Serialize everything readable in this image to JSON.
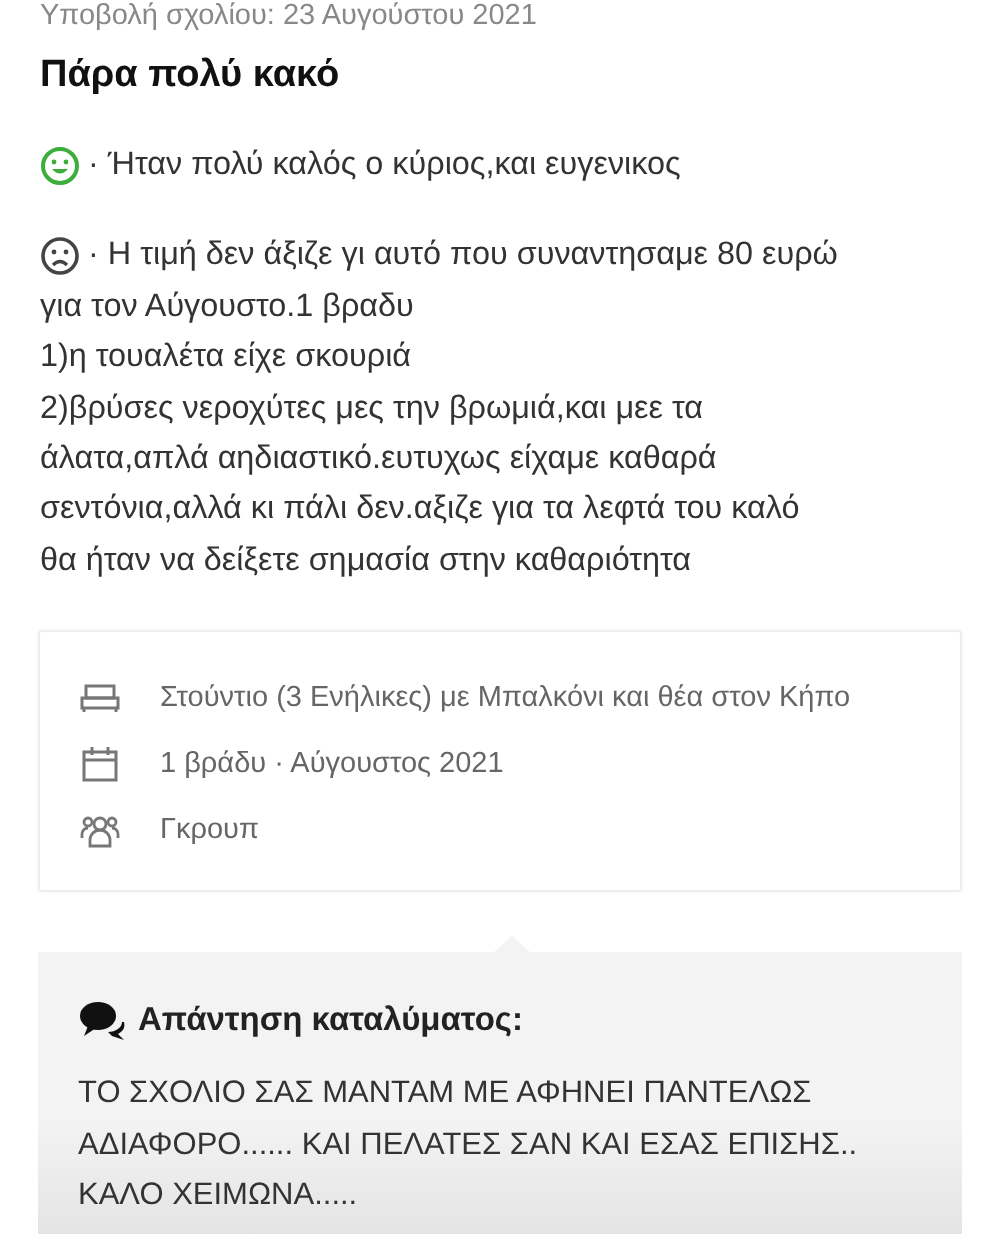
{
  "review": {
    "submitted": "Υποβολή σχολίου: 23 Αυγούστου 2021",
    "title": "Πάρα πολύ κακό",
    "comments": [
      {
        "kind": "positive",
        "text": "· Ήταν πολύ καλός ο κύριος,και ευγενικος"
      },
      {
        "kind": "negative",
        "text": "· Η τιμή δεν άξιζε γι αυτό που συναντησαμε 80 ευρώ",
        "more_lines": [
          "για τον Αύγουστο.1 βραδυ",
          "1)η τουαλέτα είχε σκουριά",
          "2)βρύσες νεροχύτες μες την βρωμιά,και μεε τα",
          "άλατα,απλά αηδιαστικό.ευτυχως είχαμε καθαρά",
          "σεντόνια,αλλά κι πάλι δεν.αξιζε για τα λεφτά του καλό",
          "θα ήταν να δείξετε σημασία στην καθαριότητα"
        ]
      }
    ]
  },
  "stay": [
    {
      "kind": "room",
      "text": "Στούντιο (3 Ενήλικες) με Μπαλκόνι και θέα στον Κήπο"
    },
    {
      "kind": "dates",
      "text": "1 βράδυ · Αύγουστος 2021"
    },
    {
      "kind": "group",
      "text": "Γκρουπ"
    }
  ],
  "reply": {
    "heading": "Απάντηση καταλύματος:",
    "text": "ΤΟ ΣΧΟΛΙΟ ΣΑΣ ΜΑΝΤΑΜ ΜΕ ΑΦΗΝΕΙ ΠΑΝΤΕΛΩΣ ΑΔΙΑΦΟΡΟ...... ΚΑΙ ΠΕΛΑΤΕΣ ΣΑΝ ΚΑΙ ΕΣΑΣ ΕΠΙΣΗΣ.. ΚΑΛΟ ΧΕΙΜΩΝΑ....."
  }
}
